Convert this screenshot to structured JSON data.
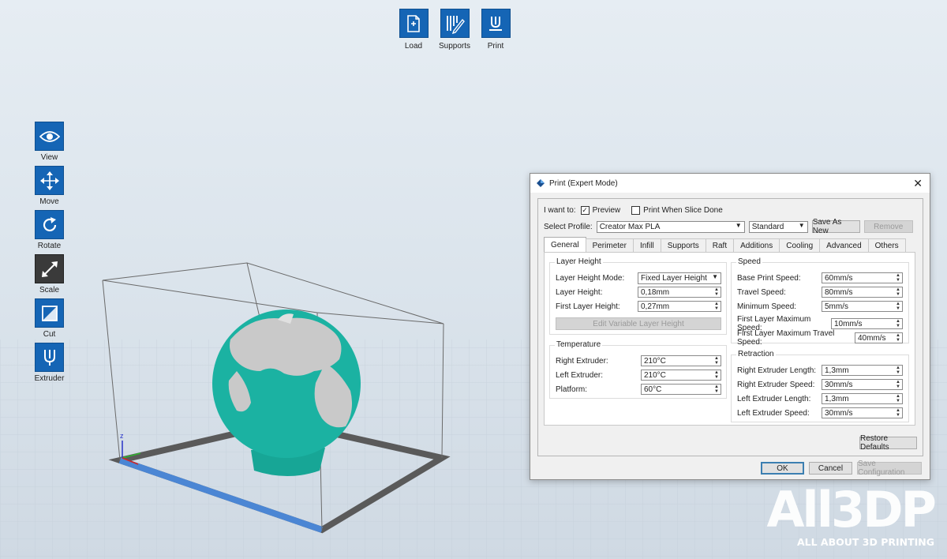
{
  "top_toolbar": {
    "load": {
      "label": "Load",
      "icon": "load-file-icon"
    },
    "supports": {
      "label": "Supports",
      "icon": "supports-icon"
    },
    "print": {
      "label": "Print",
      "icon": "print-icon"
    }
  },
  "left_toolbar": {
    "view": {
      "label": "View",
      "icon": "eye-icon"
    },
    "move": {
      "label": "Move",
      "icon": "move-arrows-icon"
    },
    "rotate": {
      "label": "Rotate",
      "icon": "rotate-icon"
    },
    "scale": {
      "label": "Scale",
      "icon": "scale-icon",
      "active": true
    },
    "cut": {
      "label": "Cut",
      "icon": "cut-icon"
    },
    "extruder": {
      "label": "Extruder",
      "icon": "extruder-icon"
    }
  },
  "axes": {
    "z": "z"
  },
  "dialog": {
    "title": "Print (Expert Mode)",
    "i_want_to": "I want to:",
    "preview_label": "Preview",
    "preview_checked": true,
    "print_when_done_label": "Print When Slice Done",
    "print_when_done_checked": false,
    "select_profile_label": "Select Profile:",
    "profile_value": "Creator Max PLA",
    "quality_value": "Standard",
    "save_as_new": "Save As New",
    "remove": "Remove",
    "tabs": [
      "General",
      "Perimeter",
      "Infill",
      "Supports",
      "Raft",
      "Additions",
      "Cooling",
      "Advanced",
      "Others"
    ],
    "active_tab": "General",
    "layer_height": {
      "title": "Layer Height",
      "mode_label": "Layer Height Mode:",
      "mode_value": "Fixed Layer Height",
      "height_label": "Layer Height:",
      "height_value": "0,18mm",
      "first_label": "First Layer Height:",
      "first_value": "0,27mm",
      "edit_variable": "Edit Variable Layer Height"
    },
    "temperature": {
      "title": "Temperature",
      "right_label": "Right Extruder:",
      "right_value": "210°C",
      "left_label": "Left Extruder:",
      "left_value": "210°C",
      "platform_label": "Platform:",
      "platform_value": "60°C"
    },
    "speed": {
      "title": "Speed",
      "base_label": "Base Print Speed:",
      "base_value": "60mm/s",
      "travel_label": "Travel Speed:",
      "travel_value": "80mm/s",
      "min_label": "Minimum Speed:",
      "min_value": "5mm/s",
      "first_max_label": "First Layer Maximum Speed:",
      "first_max_value": "10mm/s",
      "first_travel_label": "First Layer Maximum Travel Speed:",
      "first_travel_value": "40mm/s"
    },
    "retraction": {
      "title": "Retraction",
      "right_len_label": "Right Extruder Length:",
      "right_len_value": "1,3mm",
      "right_speed_label": "Right Extruder Speed:",
      "right_speed_value": "30mm/s",
      "left_len_label": "Left Extruder Length:",
      "left_len_value": "1,3mm",
      "left_speed_label": "Left Extruder Speed:",
      "left_speed_value": "30mm/s"
    },
    "restore_defaults": "Restore Defaults",
    "ok": "OK",
    "cancel": "Cancel",
    "save_configuration": "Save Configuration"
  },
  "watermark": {
    "big": "All3DP",
    "small": "ALL ABOUT 3D PRINTING"
  },
  "colors": {
    "accent": "#1565b5",
    "globe": "#1bb2a2",
    "land": "#c9c9c9"
  }
}
